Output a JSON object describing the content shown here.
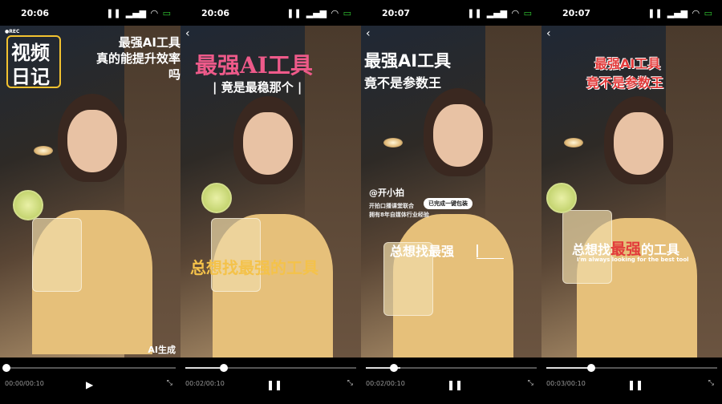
{
  "frames": [
    {
      "status_time": "20:06",
      "rec_label": "●REC",
      "diary_line1": "视频",
      "diary_line2": "日记",
      "title_line1": "最强AI工具",
      "title_line2": "真的能提升效率",
      "title_line3": "吗",
      "badge": "AI生成",
      "time": "00:00/00:10",
      "play_icon": "play-icon",
      "progress": 0.0
    },
    {
      "status_time": "20:06",
      "title": "最强AI工具",
      "subtitle": "| 竟是最稳那个 |",
      "caption": "总想找最强的工具",
      "time": "00:02/00:10",
      "play_icon": "pause-icon",
      "progress": 0.2
    },
    {
      "status_time": "20:07",
      "title_line1": "最强AI工具",
      "title_line2": "竟不是参数王",
      "handle": "@开小拍",
      "sticker_button": "已完成一键包装",
      "sticker_desc1": "开拍口播课堂联合",
      "sticker_desc2": "拥有8年自媒体行业经验",
      "caption": "总想找最强",
      "time": "00:02/00:10",
      "play_icon": "pause-icon",
      "progress": 0.2
    },
    {
      "status_time": "20:07",
      "title_line1": "最强AI工具",
      "title_line2": "竟不是参数王",
      "caption_pre": "总想找",
      "caption_hl": "最强",
      "caption_post": "的工具",
      "caption_en": "I'm always looking for the best tool",
      "time": "00:03/00:10",
      "play_icon": "pause-icon",
      "progress": 0.3
    }
  ]
}
